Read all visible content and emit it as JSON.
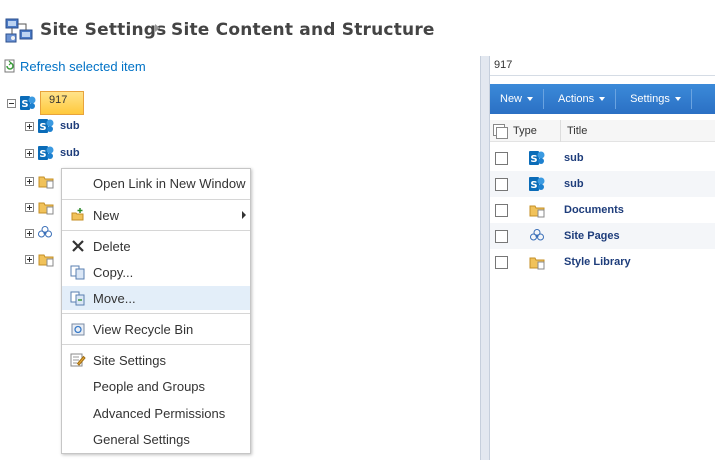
{
  "header": {
    "crumb_site_settings": "Site Settings",
    "crumb_current": "Site Content and Structure"
  },
  "tree": {
    "refresh_label": "Refresh selected item",
    "root_label": "917",
    "items": [
      {
        "label": "sub",
        "icon": "sharepoint-site-icon"
      },
      {
        "label": "sub",
        "icon": "sharepoint-site-icon"
      },
      {
        "label": "",
        "icon": "document-library-icon"
      },
      {
        "label": "",
        "icon": "document-library-icon"
      },
      {
        "label": "",
        "icon": "site-pages-icon"
      },
      {
        "label": "",
        "icon": "document-library-icon"
      }
    ]
  },
  "context_menu": {
    "open_new_window": "Open Link in New Window",
    "new": "New",
    "delete": "Delete",
    "copy": "Copy...",
    "move": "Move...",
    "recycle_bin": "View Recycle Bin",
    "site_settings": "Site Settings",
    "people_groups": "People and Groups",
    "advanced_permissions": "Advanced Permissions",
    "general_settings": "General Settings"
  },
  "right_pane": {
    "path": "917",
    "toolbar": {
      "new": "New",
      "actions": "Actions",
      "settings": "Settings"
    },
    "columns": {
      "type": "Type",
      "title": "Title"
    },
    "rows": [
      {
        "title": "sub",
        "icon": "sharepoint-site-icon"
      },
      {
        "title": "sub",
        "icon": "sharepoint-site-icon"
      },
      {
        "title": "Documents",
        "icon": "document-library-icon"
      },
      {
        "title": "Site Pages",
        "icon": "site-pages-icon"
      },
      {
        "title": "Style Library",
        "icon": "document-library-icon"
      }
    ]
  },
  "colors": {
    "link_blue": "#0072c6",
    "label_navy": "#1e3d7b",
    "toolbar_blue": "#2b70c4",
    "selection_gold": "#ffc93c",
    "menu_hover": "#e3eef9"
  }
}
